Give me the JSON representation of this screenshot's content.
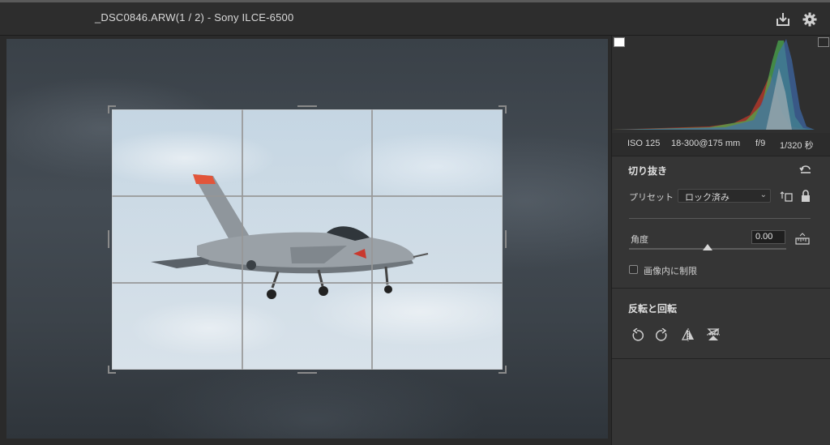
{
  "window": {
    "title": "_DSC0846.ARW(1 / 2)  -  Sony ILCE-6500"
  },
  "toolbar": {
    "save_icon": "save-icon",
    "settings_icon": "gear-icon"
  },
  "exif": {
    "iso": "ISO 125",
    "lens": "18-300@175 mm",
    "aperture": "f/9",
    "shutter": "1/320 秒"
  },
  "crop": {
    "title": "切り抜き",
    "preset_label": "プリセット",
    "preset_value": "ロック済み",
    "angle_label": "角度",
    "angle_value": "0.00",
    "constrain_label": "画像内に制限",
    "constrain_checked": false
  },
  "transform": {
    "title": "反転と回転",
    "buttons": [
      "rotate-left-icon",
      "rotate-right-icon",
      "flip-horizontal-icon",
      "flip-vertical-icon"
    ]
  },
  "colors": {
    "accent": "#d8d8d8",
    "panel_bg": "#353535",
    "hist_red": "#c0392b",
    "hist_green": "#4caf50",
    "hist_blue": "#3f6fb5"
  }
}
